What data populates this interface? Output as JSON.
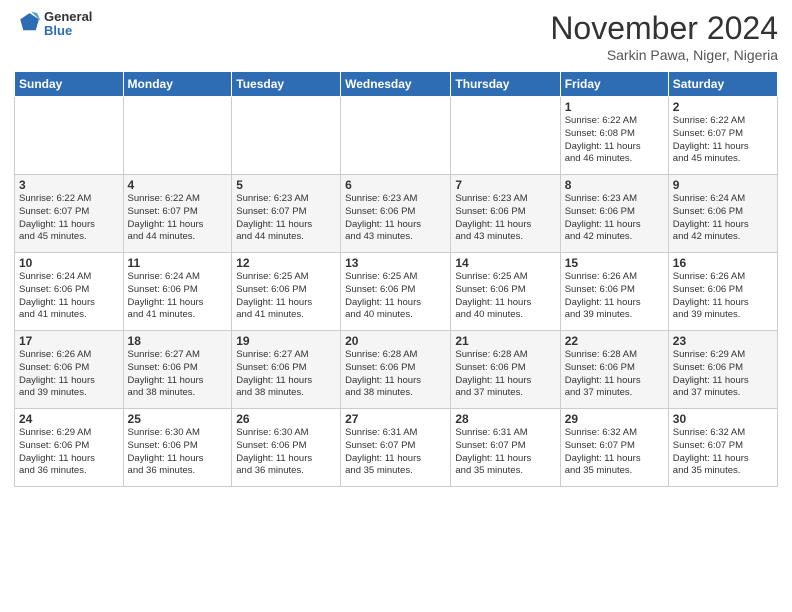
{
  "header": {
    "logo_general": "General",
    "logo_blue": "Blue",
    "month_title": "November 2024",
    "location": "Sarkin Pawa, Niger, Nigeria"
  },
  "weekdays": [
    "Sunday",
    "Monday",
    "Tuesday",
    "Wednesday",
    "Thursday",
    "Friday",
    "Saturday"
  ],
  "weeks": [
    [
      {
        "day": "",
        "info": ""
      },
      {
        "day": "",
        "info": ""
      },
      {
        "day": "",
        "info": ""
      },
      {
        "day": "",
        "info": ""
      },
      {
        "day": "",
        "info": ""
      },
      {
        "day": "1",
        "info": "Sunrise: 6:22 AM\nSunset: 6:08 PM\nDaylight: 11 hours\nand 46 minutes."
      },
      {
        "day": "2",
        "info": "Sunrise: 6:22 AM\nSunset: 6:07 PM\nDaylight: 11 hours\nand 45 minutes."
      }
    ],
    [
      {
        "day": "3",
        "info": "Sunrise: 6:22 AM\nSunset: 6:07 PM\nDaylight: 11 hours\nand 45 minutes."
      },
      {
        "day": "4",
        "info": "Sunrise: 6:22 AM\nSunset: 6:07 PM\nDaylight: 11 hours\nand 44 minutes."
      },
      {
        "day": "5",
        "info": "Sunrise: 6:23 AM\nSunset: 6:07 PM\nDaylight: 11 hours\nand 44 minutes."
      },
      {
        "day": "6",
        "info": "Sunrise: 6:23 AM\nSunset: 6:06 PM\nDaylight: 11 hours\nand 43 minutes."
      },
      {
        "day": "7",
        "info": "Sunrise: 6:23 AM\nSunset: 6:06 PM\nDaylight: 11 hours\nand 43 minutes."
      },
      {
        "day": "8",
        "info": "Sunrise: 6:23 AM\nSunset: 6:06 PM\nDaylight: 11 hours\nand 42 minutes."
      },
      {
        "day": "9",
        "info": "Sunrise: 6:24 AM\nSunset: 6:06 PM\nDaylight: 11 hours\nand 42 minutes."
      }
    ],
    [
      {
        "day": "10",
        "info": "Sunrise: 6:24 AM\nSunset: 6:06 PM\nDaylight: 11 hours\nand 41 minutes."
      },
      {
        "day": "11",
        "info": "Sunrise: 6:24 AM\nSunset: 6:06 PM\nDaylight: 11 hours\nand 41 minutes."
      },
      {
        "day": "12",
        "info": "Sunrise: 6:25 AM\nSunset: 6:06 PM\nDaylight: 11 hours\nand 41 minutes."
      },
      {
        "day": "13",
        "info": "Sunrise: 6:25 AM\nSunset: 6:06 PM\nDaylight: 11 hours\nand 40 minutes."
      },
      {
        "day": "14",
        "info": "Sunrise: 6:25 AM\nSunset: 6:06 PM\nDaylight: 11 hours\nand 40 minutes."
      },
      {
        "day": "15",
        "info": "Sunrise: 6:26 AM\nSunset: 6:06 PM\nDaylight: 11 hours\nand 39 minutes."
      },
      {
        "day": "16",
        "info": "Sunrise: 6:26 AM\nSunset: 6:06 PM\nDaylight: 11 hours\nand 39 minutes."
      }
    ],
    [
      {
        "day": "17",
        "info": "Sunrise: 6:26 AM\nSunset: 6:06 PM\nDaylight: 11 hours\nand 39 minutes."
      },
      {
        "day": "18",
        "info": "Sunrise: 6:27 AM\nSunset: 6:06 PM\nDaylight: 11 hours\nand 38 minutes."
      },
      {
        "day": "19",
        "info": "Sunrise: 6:27 AM\nSunset: 6:06 PM\nDaylight: 11 hours\nand 38 minutes."
      },
      {
        "day": "20",
        "info": "Sunrise: 6:28 AM\nSunset: 6:06 PM\nDaylight: 11 hours\nand 38 minutes."
      },
      {
        "day": "21",
        "info": "Sunrise: 6:28 AM\nSunset: 6:06 PM\nDaylight: 11 hours\nand 37 minutes."
      },
      {
        "day": "22",
        "info": "Sunrise: 6:28 AM\nSunset: 6:06 PM\nDaylight: 11 hours\nand 37 minutes."
      },
      {
        "day": "23",
        "info": "Sunrise: 6:29 AM\nSunset: 6:06 PM\nDaylight: 11 hours\nand 37 minutes."
      }
    ],
    [
      {
        "day": "24",
        "info": "Sunrise: 6:29 AM\nSunset: 6:06 PM\nDaylight: 11 hours\nand 36 minutes."
      },
      {
        "day": "25",
        "info": "Sunrise: 6:30 AM\nSunset: 6:06 PM\nDaylight: 11 hours\nand 36 minutes."
      },
      {
        "day": "26",
        "info": "Sunrise: 6:30 AM\nSunset: 6:06 PM\nDaylight: 11 hours\nand 36 minutes."
      },
      {
        "day": "27",
        "info": "Sunrise: 6:31 AM\nSunset: 6:07 PM\nDaylight: 11 hours\nand 35 minutes."
      },
      {
        "day": "28",
        "info": "Sunrise: 6:31 AM\nSunset: 6:07 PM\nDaylight: 11 hours\nand 35 minutes."
      },
      {
        "day": "29",
        "info": "Sunrise: 6:32 AM\nSunset: 6:07 PM\nDaylight: 11 hours\nand 35 minutes."
      },
      {
        "day": "30",
        "info": "Sunrise: 6:32 AM\nSunset: 6:07 PM\nDaylight: 11 hours\nand 35 minutes."
      }
    ]
  ]
}
